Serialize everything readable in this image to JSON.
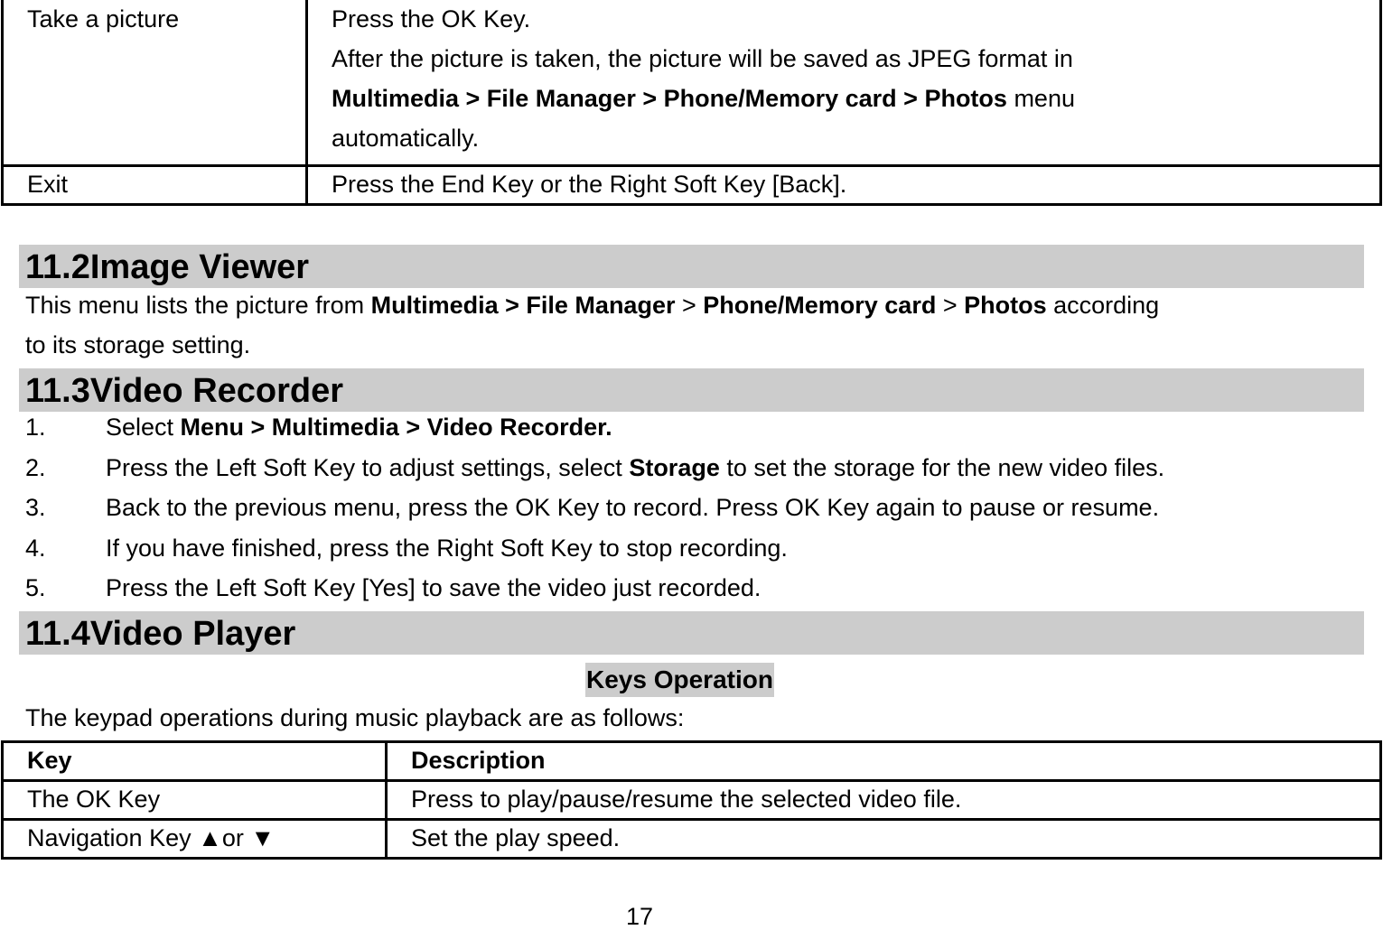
{
  "top_table": {
    "rows": [
      {
        "key": "Take a picture",
        "desc_lines": {
          "l1": "Press the OK Key.",
          "l2": "After the picture is taken, the picture will be saved as JPEG format in",
          "l3_bold": "Multimedia > File Manager > Phone/Memory card > Photos",
          "l3_rest": " menu",
          "l4": "automatically."
        }
      },
      {
        "key": "Exit",
        "desc": "Press the End Key or the Right Soft Key [Back]."
      }
    ]
  },
  "section_11_2": {
    "heading": "11.2Image Viewer",
    "para": {
      "t1": "This menu lists the picture from ",
      "b1": "Multimedia > File Manager",
      "t2": " > ",
      "b2": "Phone/Memory card",
      "t3": " > ",
      "b3": "Photos",
      "t4": " according",
      "line2": "to its storage setting."
    }
  },
  "section_11_3": {
    "heading": "11.3Video Recorder",
    "steps": [
      {
        "num": "1.",
        "pre": "Select ",
        "bold": "Menu > Multimedia > Video Recorder.",
        "post": ""
      },
      {
        "num": "2.",
        "pre": "Press the Left Soft Key to adjust settings, select ",
        "bold": "Storage",
        "post": " to set the storage for the new video files."
      },
      {
        "num": "3.",
        "pre": "Back to the previous menu, press the OK Key to record. Press OK Key again to pause or resume.",
        "bold": "",
        "post": ""
      },
      {
        "num": "4.",
        "pre": "If you have finished, press the Right Soft Key to stop recording.",
        "bold": "",
        "post": ""
      },
      {
        "num": "5.",
        "pre": "Press the Left Soft Key [Yes] to save the video just recorded.",
        "bold": "",
        "post": ""
      }
    ]
  },
  "section_11_4": {
    "heading": "11.4Video Player",
    "caption": "Keys Operation",
    "intro": "The keypad operations during music playback are as follows:",
    "table": {
      "headers": {
        "key": "Key",
        "description": "Description"
      },
      "rows": [
        {
          "key": "The OK Key",
          "description": "Press to play/pause/resume the selected video file."
        },
        {
          "key": "Navigation Key ▲or ▼",
          "description": "Set the play speed."
        }
      ]
    }
  },
  "footer": {
    "page_number": "17"
  }
}
